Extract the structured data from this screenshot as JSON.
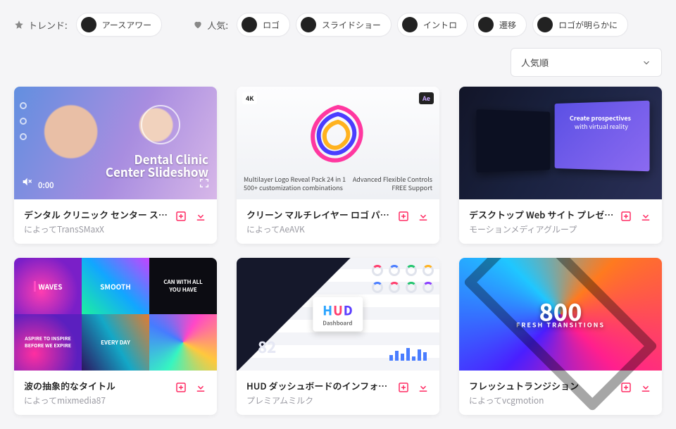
{
  "topbar": {
    "trend_label": "トレンド:",
    "trend_chip": {
      "label": "アースアワー"
    },
    "popular_label": "人気:",
    "chips": [
      {
        "label": "ロゴ"
      },
      {
        "label": "スライドショー"
      },
      {
        "label": "イントロ"
      },
      {
        "label": "遷移"
      },
      {
        "label": "ロゴが明らかに"
      }
    ]
  },
  "sort": {
    "selected": "人気順"
  },
  "cards": [
    {
      "title": "デンタル クリニック センター スライ...",
      "byline": "によってTransSMaxX",
      "preview": {
        "heading1": "Dental Clinic",
        "heading2": "Center Slideshow",
        "time": "0:00"
      }
    },
    {
      "title": "クリーン マルチレイヤー ロゴ パック",
      "byline": "によってAeAVK",
      "preview": {
        "badge4k": "4K",
        "badgeAe": "Ae",
        "line1": "Multilayer Logo Reveal Pack 24 in 1",
        "line2": "500+ customization combinations",
        "line3": "Advanced Flexible Controls",
        "line4": "FREE Support"
      }
    },
    {
      "title": "デスクトップ Web サイト プレゼンテ...",
      "byline": "モーションメディアグループ",
      "preview": {
        "tag1": "Create prospectives",
        "tag2": "with virtual reality"
      }
    },
    {
      "title": "波の抽象的なタイトル",
      "byline": "によってmixmedia87",
      "preview": {
        "t1": "WAVES",
        "t2": "SMOOTH",
        "t3": "CAN WITH ALL\nYOU HAVE",
        "t4": "ASPIRE TO INSPIRE\nBEFORE WE EXPIRE",
        "t5": "EVERY DAY"
      }
    },
    {
      "title": "HUD ダッシュボードのインフォグラ...",
      "byline": "プレミアムミルク",
      "preview": {
        "brand": "HUD",
        "sub": "Dashboard",
        "num": "82"
      }
    },
    {
      "title": "フレッシュトランジション",
      "byline": "によってvcgmotion",
      "preview": {
        "big": "800",
        "sub": "FRESH TRANSITIONS"
      }
    }
  ],
  "icons": {
    "collect_tip": "add-to-collection",
    "download_tip": "download"
  }
}
